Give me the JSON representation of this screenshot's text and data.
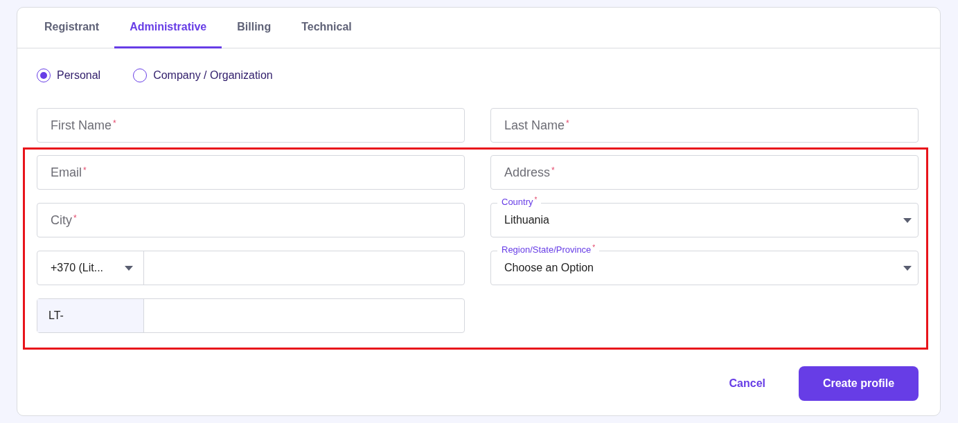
{
  "tabs": [
    {
      "label": "Registrant",
      "selected": false
    },
    {
      "label": "Administrative",
      "selected": true
    },
    {
      "label": "Billing",
      "selected": false
    },
    {
      "label": "Technical",
      "selected": false
    }
  ],
  "contact_type": [
    {
      "label": "Personal",
      "selected": true
    },
    {
      "label": "Company / Organization",
      "selected": false
    }
  ],
  "name_row": [
    {
      "kind": "text",
      "placeholder": "First Name",
      "required_mark": "*"
    },
    {
      "kind": "text",
      "placeholder": "Last Name",
      "required_mark": "*"
    }
  ],
  "highlighted_section": {
    "left": [
      {
        "kind": "text",
        "placeholder": "Email",
        "required_mark": "*"
      },
      {
        "kind": "text",
        "placeholder": "City",
        "required_mark": "*"
      },
      {
        "kind": "phone",
        "code": "+370 (Lit..."
      },
      {
        "kind": "prefixed",
        "prefix": "LT-"
      }
    ],
    "right": [
      {
        "kind": "text",
        "placeholder": "Address",
        "required_mark": "*"
      },
      {
        "kind": "select",
        "label": "Country",
        "required_mark": "*",
        "value": "Lithuania"
      },
      {
        "kind": "select",
        "label": "Region/State/Province",
        "required_mark": "*",
        "value": "Choose an Option"
      }
    ]
  },
  "buttons": {
    "cancel": "Cancel",
    "submit": "Create profile"
  }
}
